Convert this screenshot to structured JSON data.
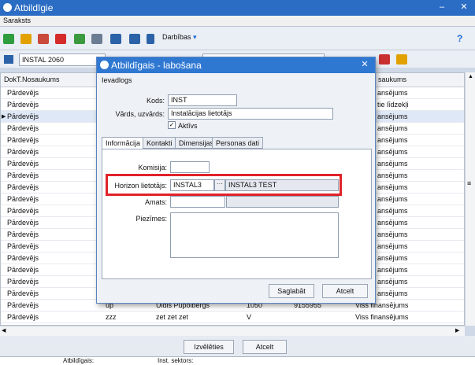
{
  "outer": {
    "title": "Atbildīgie",
    "menu": "Saraksts",
    "actions_label": "Darbības",
    "filter_value": "INSTAL 2060",
    "columns": [
      "DokT.Nosaukums",
      "saukums"
    ],
    "rows": [
      {
        "doc": "Pārdevējs",
        "right": "ansējums"
      },
      {
        "doc": "Pārdevējs",
        "right": "tie līdzekļi"
      },
      {
        "doc": "Pārdevējs",
        "right": "ansējums"
      },
      {
        "doc": "Pārdevējs",
        "right": "ansējums"
      },
      {
        "doc": "Pārdevējs",
        "right": "ansējums"
      },
      {
        "doc": "Pārdevējs",
        "right": "ansējums"
      },
      {
        "doc": "Pārdevējs",
        "right": "ansējums"
      },
      {
        "doc": "Pārdevējs",
        "right": "ansējums"
      },
      {
        "doc": "Pārdevējs",
        "right": "ansējums"
      },
      {
        "doc": "Pārdevējs",
        "right": "ansējums"
      },
      {
        "doc": "Pārdevējs",
        "right": "ansējums"
      },
      {
        "doc": "Pārdevējs",
        "right": "ansējums"
      },
      {
        "doc": "Pārdevējs",
        "right": "ansējums"
      },
      {
        "doc": "Pārdevējs",
        "right": "ansējums"
      },
      {
        "doc": "Pārdevējs",
        "right": "ansējums"
      },
      {
        "doc": "Pārdevējs",
        "right": "ansējums"
      },
      {
        "doc": "Pārdevējs",
        "right": "ansējums"
      },
      {
        "doc": "Pārdevējs",
        "right": "ansējums"
      }
    ],
    "full_rows": [
      {
        "doc": "Pārdevējs",
        "code": "up",
        "name": "Uldis Pūpolbergs",
        "num": "1050",
        "phone": "9155955",
        "fin": "Viss finansējums"
      },
      {
        "doc": "Pārdevējs",
        "code": "zzz",
        "name": "zet zet zet",
        "num": "V",
        "phone": "",
        "fin": "Viss finansējums"
      }
    ],
    "choose_button": "Izvēlēties",
    "cancel_button": "Atcelt",
    "status_responsible": "Atbildīgais:",
    "status_sector": "Inst. sektors:"
  },
  "dialog": {
    "title": "Atbildīgais - labošana",
    "section": "Ievadlogs",
    "code_label": "Kods:",
    "code_value": "INST",
    "name_label": "Vārds, uzvārds:",
    "name_value": "Instalācijas lietotājs",
    "active_label": "Aktīvs",
    "active_checked": true,
    "tabs": [
      "Informācija",
      "Kontakti",
      "Dimensijas",
      "Personas dati"
    ],
    "commission_label": "Komisija:",
    "horizon_label": "Horizon lietotājs:",
    "horizon_value": "INSTAL3",
    "horizon_lookup": "···",
    "horizon_name": "INSTAL3  TEST",
    "position_label": "Amats:",
    "notes_label": "Piezīmes:",
    "save_button": "Saglabāt",
    "cancel_button": "Atcelt"
  },
  "colors": {
    "title_bar": "#2b6cc4",
    "highlight": "#e0222a"
  }
}
